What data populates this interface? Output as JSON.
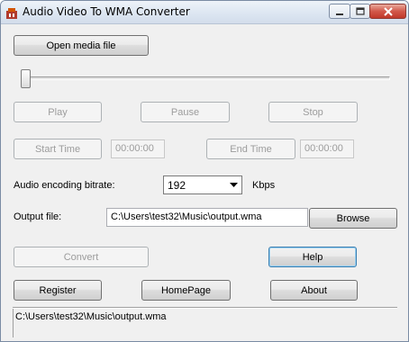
{
  "window": {
    "title": "Audio Video To WMA Converter",
    "icon": "app-icon",
    "controls": {
      "minimize": "minimize-icon",
      "maximize": "maximize-icon",
      "close": "close-icon"
    }
  },
  "buttons": {
    "open_media": "Open media file",
    "play": "Play",
    "pause": "Pause",
    "stop": "Stop",
    "start_time": "Start Time",
    "end_time": "End Time",
    "browse": "Browse",
    "convert": "Convert",
    "help": "Help",
    "register": "Register",
    "homepage": "HomePage",
    "about": "About"
  },
  "seek": {
    "position": 0.0
  },
  "times": {
    "start_value": "00:00:00",
    "end_value": "00:00:00"
  },
  "bitrate": {
    "label": "Audio encoding bitrate:",
    "selected": "192",
    "unit": "Kbps"
  },
  "output": {
    "label": "Output file:",
    "path": "C:\\Users\\test32\\Music\\output.wma"
  },
  "status": {
    "text": "C:\\Users\\test32\\Music\\output.wma"
  },
  "colors": {
    "window_bg": "#f0f0f0",
    "titlebar_bg": "#dbe5f1",
    "close_button": "#c0392b",
    "disabled_text": "#9c9c9c"
  }
}
